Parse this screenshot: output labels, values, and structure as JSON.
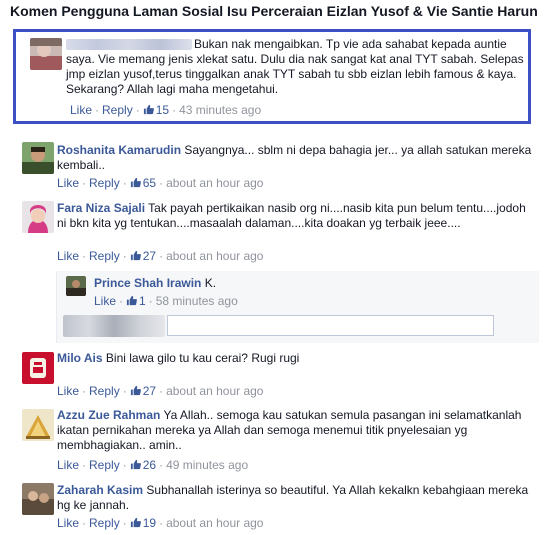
{
  "page": {
    "title": "Komen Pengguna Laman Sosial Isu Perceraian Eizlan Yusof & Vie Santie Harun"
  },
  "actions": {
    "like": "Like",
    "reply": "Reply",
    "sep": "·"
  },
  "comments": [
    {
      "author": "",
      "text": "Bukan nak mengaibkan. Tp vie ada sahabat kepada auntie saya. Vie memang jenis xlekat satu. Dulu dia nak sangat kat anal TYT sabah. Selepas jmp eizlan yusof,terus tinggalkan anak TYT sabah tu sbb eizlan lebih famous & kaya. Sekarang? Allah lagi maha mengetahui.",
      "likes": "15",
      "time": "43 minutes ago"
    },
    {
      "author": "Roshanita Kamarudin",
      "text": "Sayangnya... sblm ni depa bahagia jer... ya allah satukan mereka kembali..",
      "likes": "65",
      "time": "about an hour ago"
    },
    {
      "author": "Fara Niza Sajali",
      "text": "Tak payah pertikaikan nasib org ni....nasib kita pun belum tentu....jodoh ni bkn kita yg tentukan....masaalah dalaman....kita doakan yg terbaik jeee....",
      "likes": "27",
      "time": "about an hour ago"
    },
    {
      "author": "Milo Ais",
      "text": "Bini lawa gilo tu kau cerai? Rugi rugi",
      "likes": "27",
      "time": "about an hour ago"
    },
    {
      "author": "Azzu Zue Rahman",
      "text": "Ya Allah.. semoga kau satukan semula pasangan ini selamatkanlah ikatan pernikahan mereka ya Allah dan semoga menemui titik pnyelesaian yg membhagiakan.. amin..",
      "likes": "26",
      "time": "49 minutes ago"
    },
    {
      "author": "Zaharah Kasim",
      "text": "Subhanallah isterinya so beautiful. Ya Allah kekalkn kebahgiaan mereka hg ke jannah.",
      "likes": "19",
      "time": "about an hour ago"
    }
  ],
  "reply": {
    "author": "Prince Shah Irawin",
    "text": "K.",
    "likes": "1",
    "time": "58 minutes ago"
  },
  "reply_input": {
    "placeholder": ""
  },
  "colors": {
    "highlight_border": "#3d4fc4",
    "link": "#3b5998",
    "meta": "#90949c"
  }
}
